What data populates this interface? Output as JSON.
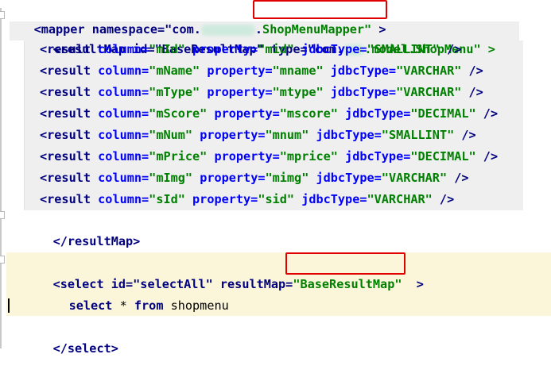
{
  "mapper": {
    "open_prefix": "<mapper namespace=\"com.",
    "open_suffix_dot": ".",
    "class_name": "ShopMenuMapper\"",
    "close_gt": " >"
  },
  "result_map": {
    "open_prefix": "<resultMap id=\"BaseResultMap\" type=\"com.",
    "open_suffix": ".model.ShopMenu\" >",
    "close": "</resultMap>",
    "results": [
      {
        "column": "mId",
        "property": "mid",
        "jdbcType": "SMALLINT"
      },
      {
        "column": "mName",
        "property": "mname",
        "jdbcType": "VARCHAR"
      },
      {
        "column": "mType",
        "property": "mtype",
        "jdbcType": "VARCHAR"
      },
      {
        "column": "mScore",
        "property": "mscore",
        "jdbcType": "DECIMAL"
      },
      {
        "column": "mNum",
        "property": "mnum",
        "jdbcType": "SMALLINT"
      },
      {
        "column": "mPrice",
        "property": "mprice",
        "jdbcType": "DECIMAL"
      },
      {
        "column": "mImg",
        "property": "mimg",
        "jdbcType": "VARCHAR"
      },
      {
        "column": "sId",
        "property": "sid",
        "jdbcType": "VARCHAR"
      }
    ]
  },
  "select_block": {
    "open_prefix": "<select id=\"selectAll\" resultMap=",
    "result_map_value": "\"BaseResultMap\"",
    "open_suffix": "  >",
    "sql_kw1": "select",
    "sql_star": " * ",
    "sql_kw2": "from",
    "sql_table": " shopmenu",
    "close": "</select>"
  },
  "colors": {
    "tag": "#000080",
    "attribute": "#0000ff",
    "string": "#008000",
    "highlight": "#fbf6da",
    "annotation_box": "#e00000"
  }
}
